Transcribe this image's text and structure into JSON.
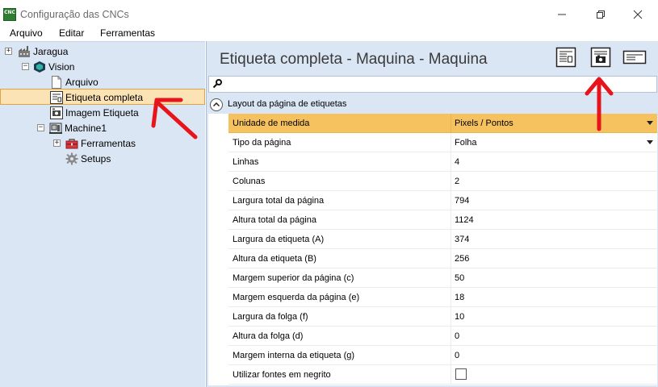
{
  "window": {
    "title": "Configuração das CNCs",
    "app_icon": "cnc-app-icon",
    "app_icon_text": "CNC"
  },
  "menu": {
    "items": [
      "Arquivo",
      "Editar",
      "Ferramentas"
    ]
  },
  "tree": {
    "root": "Jaragua",
    "vision": "Vision",
    "arquivo": "Arquivo",
    "etiqueta_completa": "Etiqueta completa",
    "imagem_etiqueta": "Imagem Etiqueta",
    "machine": "Machine1",
    "ferramentas": "Ferramentas",
    "setups": "Setups"
  },
  "panel": {
    "title": "Etiqueta completa - Maquina - Maquina",
    "toolbar_icons": [
      "full-label-icon",
      "image-label-icon",
      "text-label-icon"
    ]
  },
  "grid": {
    "group_label": "Layout da página de etiquetas",
    "rows": [
      {
        "name": "Unidade de medida",
        "value": "Pixels / Pontos"
      },
      {
        "name": "Tipo da página",
        "value": "Folha"
      },
      {
        "name": "Linhas",
        "value": "4"
      },
      {
        "name": "Colunas",
        "value": "2"
      },
      {
        "name": "Largura total da página",
        "value": "794"
      },
      {
        "name": "Altura total da página",
        "value": "1124"
      },
      {
        "name": "Largura da etiqueta (A)",
        "value": "374"
      },
      {
        "name": "Altura da etiqueta (B)",
        "value": "256"
      },
      {
        "name": "Margem superior da página (c)",
        "value": "50"
      },
      {
        "name": "Margem esquerda da página (e)",
        "value": "18"
      },
      {
        "name": "Largura da folga (f)",
        "value": "10"
      },
      {
        "name": "Altura da folga (d)",
        "value": "0"
      },
      {
        "name": "Margem interna da etiqueta (g)",
        "value": "0"
      },
      {
        "name": "Utilizar fontes em negrito",
        "value": ""
      }
    ]
  },
  "colors": {
    "panel_bg": "#dbe6f4",
    "selection": "#f6c25f",
    "annotation_arrow": "#e8141c"
  }
}
